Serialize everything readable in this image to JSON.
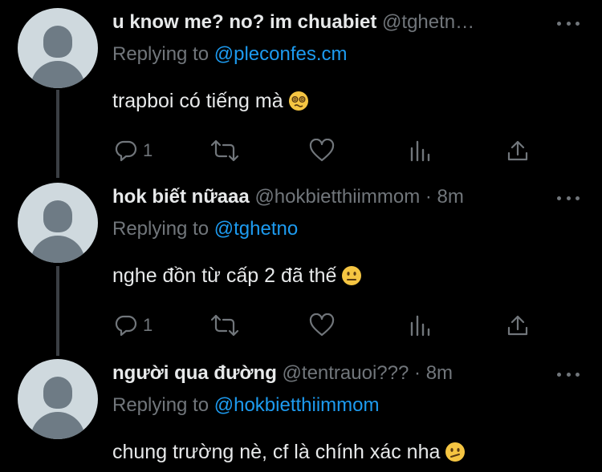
{
  "replying_prefix": "Replying to",
  "tweets": [
    {
      "name": "u know me? no? im chuabiet",
      "handle": "@tghetn…",
      "dot": "",
      "time": "",
      "replying_to": "@pleconfes.cm",
      "text": "trapboi có tiếng mà",
      "emoji": "woozy-face",
      "reply_count": "1"
    },
    {
      "name": "hok biết nữaaa",
      "handle": "@hokbietthiimmom",
      "dot": "·",
      "time": "8m",
      "replying_to": "@tghetno",
      "text": "nghe đồn từ cấp 2 đã thế",
      "emoji": "neutral-face",
      "reply_count": "1"
    },
    {
      "name": "người qua đường",
      "handle": "@tentrauoi???",
      "dot": "·",
      "time": "8m",
      "replying_to": "@hokbietthiimmom",
      "text": "chung trường nè, cf là chính xác nha",
      "emoji": "confused-face",
      "reply_count": ""
    }
  ],
  "colors": {
    "background": "#000000",
    "text": "#e7e9ea",
    "muted": "#71767b",
    "link": "#1d9bf0",
    "thread_line": "#3b3f44",
    "avatar_bg": "#cfd9de",
    "avatar_fg": "#6e7b85"
  }
}
